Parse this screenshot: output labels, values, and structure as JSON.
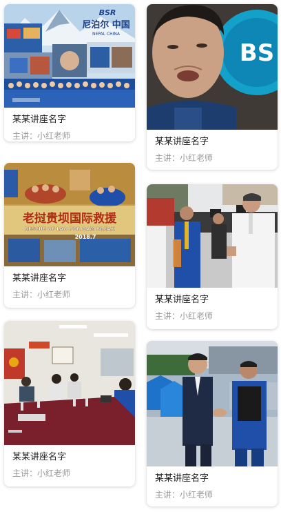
{
  "cards": [
    {
      "title": "某某讲座名字",
      "lecturer_label": "主讲：",
      "lecturer": "小红老师",
      "image_text": [
        "BSR",
        "尼泊尔 中国",
        "NEPAL   CHINA"
      ]
    },
    {
      "title": "某某讲座名字",
      "lecturer_label": "主讲：",
      "lecturer": "小红老师",
      "image_text": [
        "BS"
      ]
    },
    {
      "title": "某某讲座名字",
      "lecturer_label": "主讲：",
      "lecturer": "小红老师",
      "image_text": [
        "老挝贵坝国际救援",
        "RESCUE OF LAO PDR DAM BREAK",
        "2018.7"
      ]
    },
    {
      "title": "某某讲座名字",
      "lecturer_label": "主讲：",
      "lecturer": "小红老师",
      "image_text": []
    },
    {
      "title": "某某讲座名字",
      "lecturer_label": "主讲：",
      "lecturer": "小红老师",
      "image_text": []
    },
    {
      "title": "某某讲座名字",
      "lecturer_label": "主讲：",
      "lecturer": "小红老师",
      "image_text": []
    }
  ],
  "colors": {
    "title": "#222222",
    "lecturer": "#999999",
    "rescue_blue": "#1f4fa8",
    "banner_red": "#c0392b"
  }
}
